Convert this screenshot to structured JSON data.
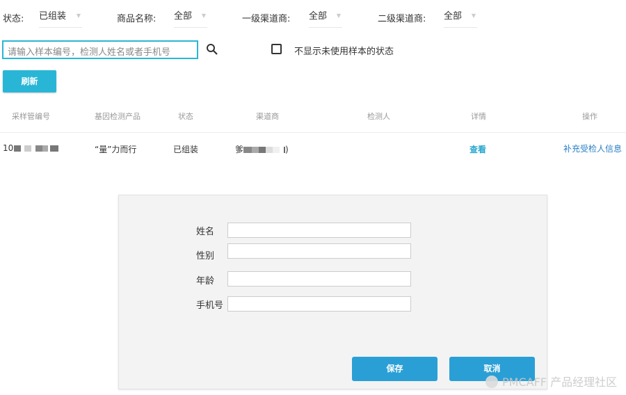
{
  "filters": [
    {
      "label": "状态:",
      "value": "已组装"
    },
    {
      "label": "商品名称:",
      "value": "全部"
    },
    {
      "label": "一级渠道商:",
      "value": "全部"
    },
    {
      "label": "二级渠道商:",
      "value": "全部"
    }
  ],
  "search": {
    "placeholder": "请输入样本编号，检测人姓名或者手机号",
    "icon": "search-icon"
  },
  "checkbox": {
    "label": "不显示未使用样本的状态",
    "checked": false
  },
  "refresh_label": "刷新",
  "table": {
    "headers": [
      "采样管编号",
      "基因检测产品",
      "状态",
      "渠道商",
      "检测人",
      "详情",
      "操作"
    ],
    "rows": [
      {
        "id": "10",
        "product": "“量”力而行",
        "status": "已组装",
        "channel_prefix": "爹",
        "channel_suffix": ")",
        "tester": "",
        "detail": "查看",
        "action": "补充受检人信息"
      }
    ]
  },
  "dialog": {
    "fields": [
      {
        "label": "姓名",
        "value": ""
      },
      {
        "label": "性别",
        "value": ""
      },
      {
        "label": "年龄",
        "value": ""
      },
      {
        "label": "手机号",
        "value": ""
      }
    ],
    "save_label": "保存",
    "cancel_label": "取消"
  },
  "watermark": "PMCAFF 产品经理社区",
  "colors": {
    "accent": "#29b6d6",
    "dialog_button": "#2a9fd6",
    "link": "#2a7fc4"
  }
}
